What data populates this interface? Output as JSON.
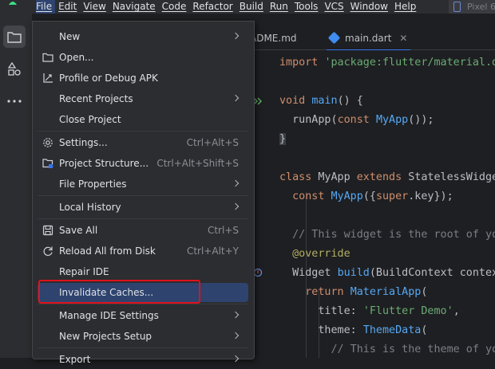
{
  "menubar": {
    "items": [
      "File",
      "Edit",
      "View",
      "Navigate",
      "Code",
      "Refactor",
      "Build",
      "Run",
      "Tools",
      "VCS",
      "Window",
      "Help"
    ],
    "device": "Pixel 6"
  },
  "file_menu": {
    "items": [
      {
        "label": "New",
        "shortcut": "",
        "submenu": true,
        "icon": ""
      },
      {
        "label": "Open...",
        "shortcut": "",
        "submenu": false,
        "icon": "folder-icon"
      },
      {
        "label": "Profile or Debug APK",
        "shortcut": "",
        "submenu": false,
        "icon": "profile-apk-icon"
      },
      {
        "label": "Recent Projects",
        "shortcut": "",
        "submenu": true,
        "icon": ""
      },
      {
        "label": "Close Project",
        "shortcut": "",
        "submenu": false,
        "icon": ""
      },
      {
        "label": "Settings...",
        "shortcut": "Ctrl+Alt+S",
        "submenu": false,
        "icon": "gear-icon"
      },
      {
        "label": "Project Structure...",
        "shortcut": "Ctrl+Alt+Shift+S",
        "submenu": false,
        "icon": "project-structure-icon"
      },
      {
        "label": "File Properties",
        "shortcut": "",
        "submenu": true,
        "icon": ""
      },
      {
        "label": "Local History",
        "shortcut": "",
        "submenu": true,
        "icon": ""
      },
      {
        "label": "Save All",
        "shortcut": "Ctrl+S",
        "submenu": false,
        "icon": "save-icon"
      },
      {
        "label": "Reload All from Disk",
        "shortcut": "Ctrl+Alt+Y",
        "submenu": false,
        "icon": "reload-icon"
      },
      {
        "label": "Repair IDE",
        "shortcut": "",
        "submenu": false,
        "icon": ""
      },
      {
        "label": "Invalidate Caches...",
        "shortcut": "",
        "submenu": false,
        "icon": ""
      },
      {
        "label": "Manage IDE Settings",
        "shortcut": "",
        "submenu": true,
        "icon": ""
      },
      {
        "label": "New Projects Setup",
        "shortcut": "",
        "submenu": true,
        "icon": ""
      },
      {
        "label": "Export",
        "shortcut": "",
        "submenu": true,
        "icon": ""
      }
    ],
    "selected": "Invalidate Caches..."
  },
  "tabs": [
    {
      "label": "ADME.md"
    },
    {
      "label": "main.dart",
      "active": true
    }
  ],
  "code_lines": [
    "import 'package:flutter/material.d",
    "",
    "void main() {",
    "  runApp(const MyApp());",
    "}",
    "",
    "class MyApp extends StatelessWidge",
    "  const MyApp({super.key});",
    "",
    "  // This widget is the root of yo",
    "  @override",
    "  Widget build(BuildContext contex",
    "    return MaterialApp(",
    "      title: 'Flutter Demo',",
    "      theme: ThemeData(",
    "        // This is the theme of yo"
  ],
  "colors": {
    "accent": "#3574f0",
    "selection": "#2e436e",
    "highlight_box": "#e0121b",
    "keyword": "#cf8e6d",
    "string": "#6aab73",
    "function": "#56a8f5"
  }
}
